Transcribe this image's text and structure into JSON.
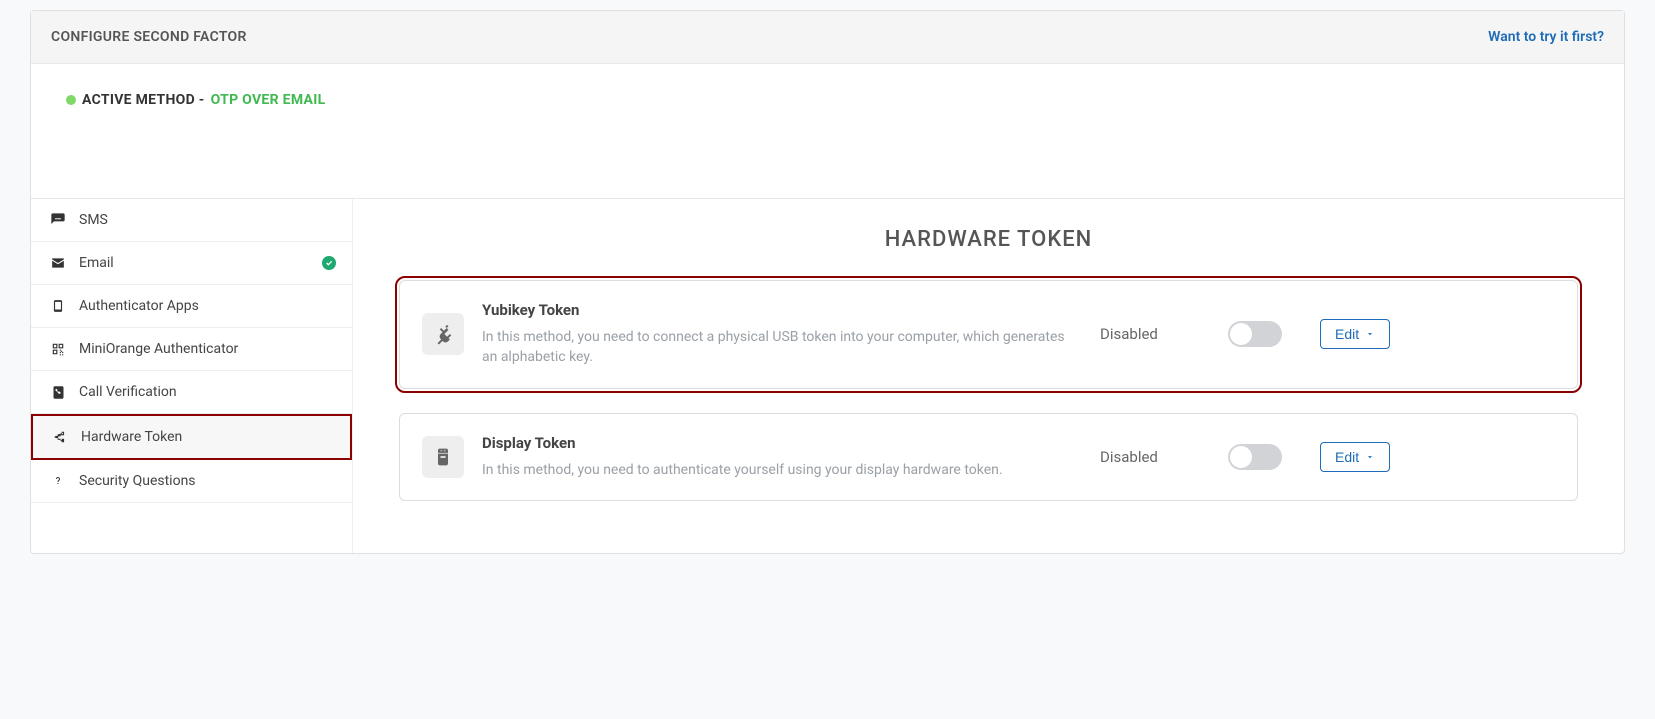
{
  "header": {
    "title": "CONFIGURE SECOND FACTOR",
    "try_link": "Want to try it first?"
  },
  "active": {
    "prefix": "ACTIVE METHOD - ",
    "value": "OTP OVER EMAIL"
  },
  "sidebar": {
    "items": [
      {
        "label": "SMS",
        "icon": "sms"
      },
      {
        "label": "Email",
        "icon": "email",
        "checked": true
      },
      {
        "label": "Authenticator Apps",
        "icon": "phone"
      },
      {
        "label": "MiniOrange Authenticator",
        "icon": "qr"
      },
      {
        "label": "Call Verification",
        "icon": "call"
      },
      {
        "label": "Hardware Token",
        "icon": "usb",
        "selected": true
      },
      {
        "label": "Security Questions",
        "icon": "question"
      }
    ]
  },
  "main": {
    "title": "HARDWARE TOKEN",
    "cards": [
      {
        "title": "Yubikey Token",
        "desc": "In this method, you need to connect a physical USB token into your computer, which generates an alphabetic key.",
        "status": "Disabled",
        "edit": "Edit",
        "highlight": true
      },
      {
        "title": "Display Token",
        "desc": "In this method, you need to authenticate yourself using your display hardware token.",
        "status": "Disabled",
        "edit": "Edit",
        "highlight": false
      }
    ]
  }
}
